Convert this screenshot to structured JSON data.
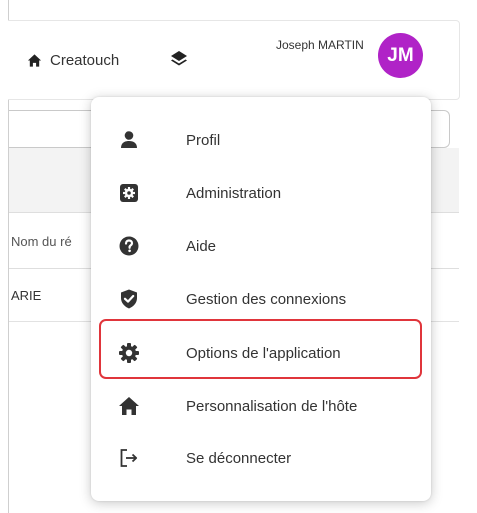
{
  "header": {
    "home_label": "Creatouch",
    "user_name": "Joseph MARTIN",
    "avatar_initials": "JM",
    "avatar_color": "#b023c7"
  },
  "table": {
    "column_header": "Nom du ré",
    "row_cell": "ARIE"
  },
  "menu": {
    "items": [
      {
        "label": "Profil",
        "icon": "user-icon"
      },
      {
        "label": "Administration",
        "icon": "admin-gear-square-icon"
      },
      {
        "label": "Aide",
        "icon": "question-circle-icon"
      },
      {
        "label": "Gestion des connexions",
        "icon": "shield-check-icon"
      },
      {
        "label": "Options de l'application",
        "icon": "gear-icon"
      },
      {
        "label": "Personnalisation de l'hôte",
        "icon": "home-icon"
      },
      {
        "label": "Se déconnecter",
        "icon": "logout-icon"
      }
    ],
    "highlighted_item": "Options de l'application",
    "highlight_color": "#e0353b"
  }
}
